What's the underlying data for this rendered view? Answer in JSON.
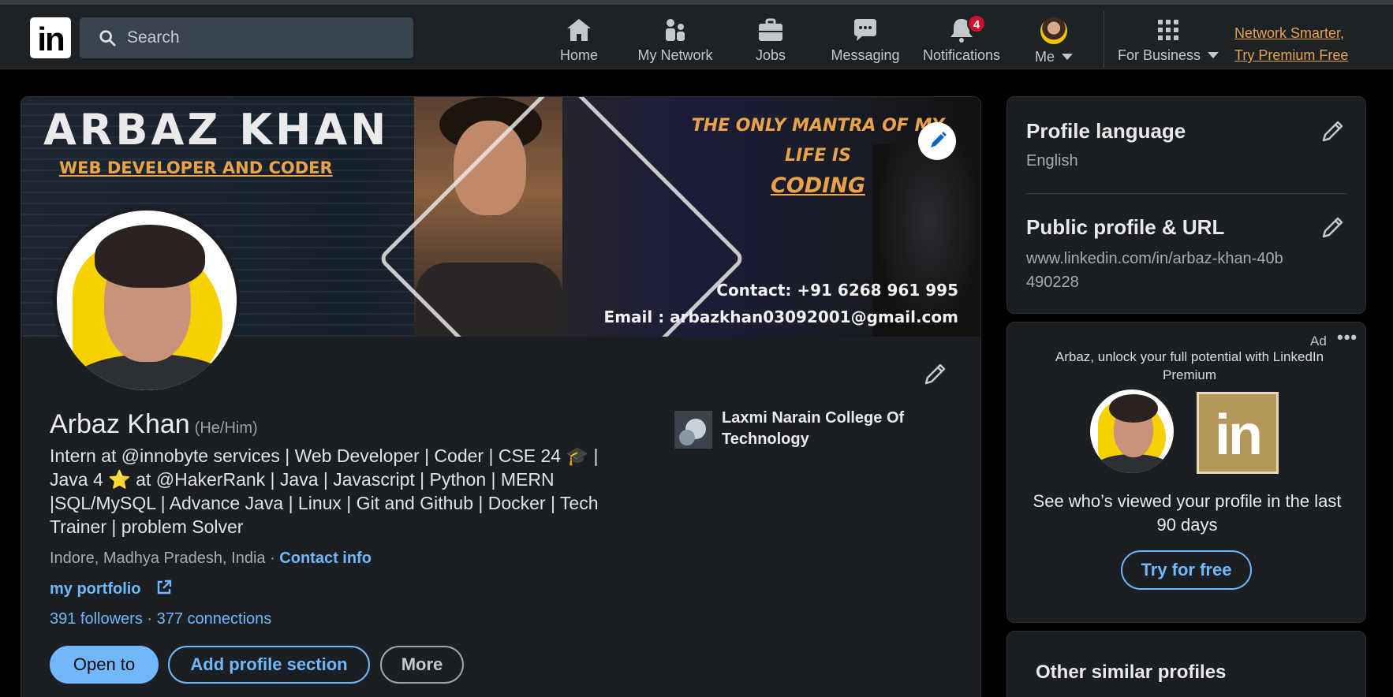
{
  "topbar": {
    "logo_text": "in",
    "search_placeholder": "Search",
    "nav": [
      {
        "label": "Home",
        "icon": "home-icon"
      },
      {
        "label": "My Network",
        "icon": "network-icon"
      },
      {
        "label": "Jobs",
        "icon": "briefcase-icon"
      },
      {
        "label": "Messaging",
        "icon": "chat-icon"
      },
      {
        "label": "Notifications",
        "icon": "bell-icon",
        "badge": "4"
      },
      {
        "label": "Me",
        "icon": "avatar"
      },
      {
        "label": "For Business",
        "icon": "grid-icon"
      }
    ],
    "premium_line1": "Network Smarter,",
    "premium_line2": "Try Premium Free"
  },
  "banner": {
    "name": "ARBAZ KHAN",
    "role": "WEB DEVELOPER AND CODER",
    "mantra_line1": "THE ONLY MANTRA OF MY LIFE IS",
    "mantra_line2": "CODING",
    "contact": "Contact: +91 6268 961 995",
    "email": "Email : arbazkhan03092001@gmail.com"
  },
  "profile": {
    "name": "Arbaz Khan",
    "pronouns": "(He/Him)",
    "headline": "Intern at @innobyte services | Web Developer | Coder | CSE 24 🎓 | Java 4 ⭐ at @HakerRank | Java | Javascript | Python | MERN |SQL/MySQL | Advance Java | Linux | Git and Github | Docker | Tech Trainer | problem Solver",
    "location": "Indore, Madhya Pradesh, India · ",
    "contact_info": "Contact info",
    "portfolio": "my portfolio",
    "followers": "391 followers",
    "connections_sep": " · ",
    "connections": "377 connections",
    "school": "Laxmi Narain College Of Technology",
    "buttons": {
      "open_to": "Open to",
      "add_section": "Add profile section",
      "more": "More"
    }
  },
  "sidebar": {
    "language_title": "Profile language",
    "language_value": "English",
    "url_title": "Public profile & URL",
    "url_value": "www.linkedin.com/in/arbaz-khan-40b490228"
  },
  "ad": {
    "label": "Ad",
    "dots": "•••",
    "text": "Arbaz, unlock your full potential with LinkedIn Premium",
    "logo_text": "in",
    "cta_text": "See who’s viewed your profile in the last 90 days",
    "button": "Try for free"
  },
  "similar": {
    "title": "Other similar profiles"
  },
  "colors": {
    "accent": "#71b7fb",
    "premium": "#e8a14e",
    "badge": "#cb112d",
    "card_bg": "#1b1f23"
  }
}
